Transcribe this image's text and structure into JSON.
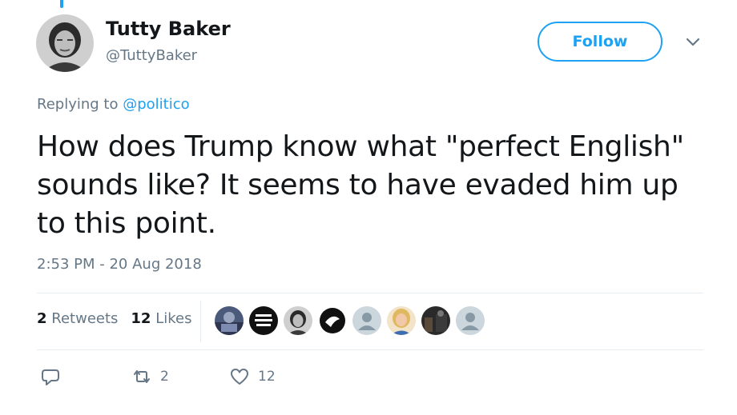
{
  "user": {
    "display_name": "Tutty Baker",
    "handle": "@TuttyBaker",
    "avatar_icon": "portrait-avatar-icon"
  },
  "follow_label": "Follow",
  "reply": {
    "prefix": "Replying to ",
    "mention": "@politico"
  },
  "tweet": {
    "text": "How does Trump know what \"perfect English\"\nsounds like?  It seems to have evaded him up\nto this point.",
    "timestamp": "2:53 PM - 20 Aug 2018"
  },
  "stats": {
    "retweets_count": "2",
    "retweets_label": "Retweets",
    "likes_count": "12",
    "likes_label": "Likes"
  },
  "likers": [
    {
      "icon": "blue-photo-avatar-icon"
    },
    {
      "icon": "march-for-our-lives-avatar-icon"
    },
    {
      "icon": "portrait-avatar-icon"
    },
    {
      "icon": "black-logo-avatar-icon"
    },
    {
      "icon": "default-profile-avatar-icon"
    },
    {
      "icon": "blonde-woman-avatar-icon"
    },
    {
      "icon": "dark-photo-avatar-icon"
    },
    {
      "icon": "default-profile-avatar-icon"
    }
  ],
  "actions": {
    "reply_icon": "reply-icon",
    "retweet_icon": "retweet-icon",
    "retweet_count": "2",
    "like_icon": "heart-icon",
    "like_count": "12"
  },
  "colors": {
    "accent": "#1da1f2",
    "text": "#14171a",
    "secondary": "#657786",
    "divider": "#e6ecf0"
  }
}
